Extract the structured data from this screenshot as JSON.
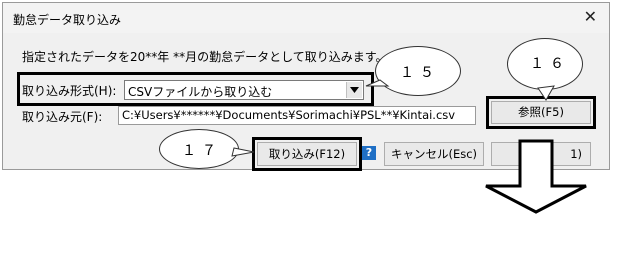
{
  "window": {
    "title": "勤怠データ取り込み",
    "close_glyph": "✕"
  },
  "hint_text": "指定されたデータを20**年 **月の勤怠データとして取り込みます。",
  "format": {
    "label": "取り込み形式(H):",
    "selected": "CSVファイルから取り込む"
  },
  "source": {
    "label": "取り込み元(F):",
    "value": "C:¥Users¥******¥Documents¥Sorimachi¥PSL**¥Kintai.csv"
  },
  "buttons": {
    "browse": "参照(F5)",
    "import": "取り込み(F12)",
    "cancel": "キャンセル(Esc)",
    "partial_fourth": "1)"
  },
  "help_glyph": "?",
  "callouts": {
    "c15": "１５",
    "c16": "１６",
    "c17": "１７"
  },
  "icons": [
    "close-icon",
    "dropdown-arrow-icon",
    "help-icon",
    "down-arrow-icon"
  ]
}
